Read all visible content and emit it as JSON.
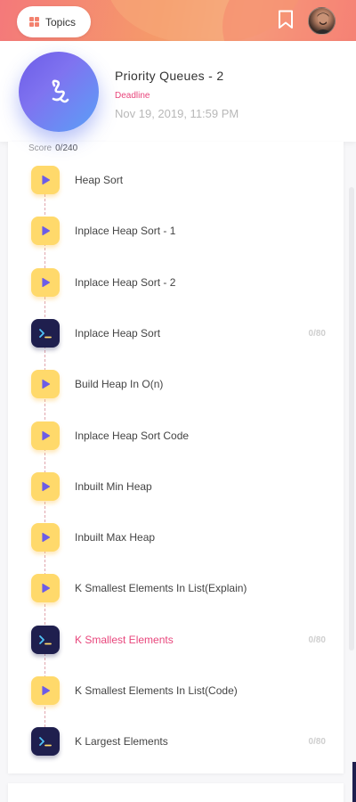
{
  "header": {
    "topics_label": "Topics",
    "icons": {
      "grid": "grid-icon",
      "bookmark": "bookmark-icon",
      "avatar": "user-avatar"
    },
    "colors": {
      "gradient_start": "#f4797a",
      "gradient_end": "#f47b7e"
    }
  },
  "module": {
    "title": "Priority Queues - 2",
    "deadline_label": "Deadline",
    "deadline_value": "Nov 19, 2019, 11:59 PM",
    "logo_icon": "squiggle-logo-icon"
  },
  "score": {
    "label": "Score",
    "value": "0/240"
  },
  "items": [
    {
      "label": "Heap Sort",
      "type": "video",
      "score": ""
    },
    {
      "label": "Inplace Heap Sort - 1",
      "type": "video",
      "score": ""
    },
    {
      "label": "Inplace Heap Sort - 2",
      "type": "video",
      "score": ""
    },
    {
      "label": "Inplace Heap Sort",
      "type": "code",
      "score": "0/80"
    },
    {
      "label": "Build Heap In O(n)",
      "type": "video",
      "score": ""
    },
    {
      "label": "Inplace Heap Sort Code",
      "type": "video",
      "score": ""
    },
    {
      "label": "Inbuilt Min Heap",
      "type": "video",
      "score": ""
    },
    {
      "label": "Inbuilt Max Heap",
      "type": "video",
      "score": ""
    },
    {
      "label": "K Smallest Elements In List(Explain)",
      "type": "video",
      "score": ""
    },
    {
      "label": "K Smallest Elements",
      "type": "code",
      "score": "0/80",
      "active": true
    },
    {
      "label": "K Smallest Elements In List(Code)",
      "type": "video",
      "score": ""
    },
    {
      "label": "K Largest Elements",
      "type": "code",
      "score": "0/80"
    }
  ],
  "colors": {
    "accent": "#e8467c",
    "video_icon_bg": "#ffd96b",
    "code_icon_bg": "#1f1f4e",
    "play": "#6c5ce7"
  }
}
